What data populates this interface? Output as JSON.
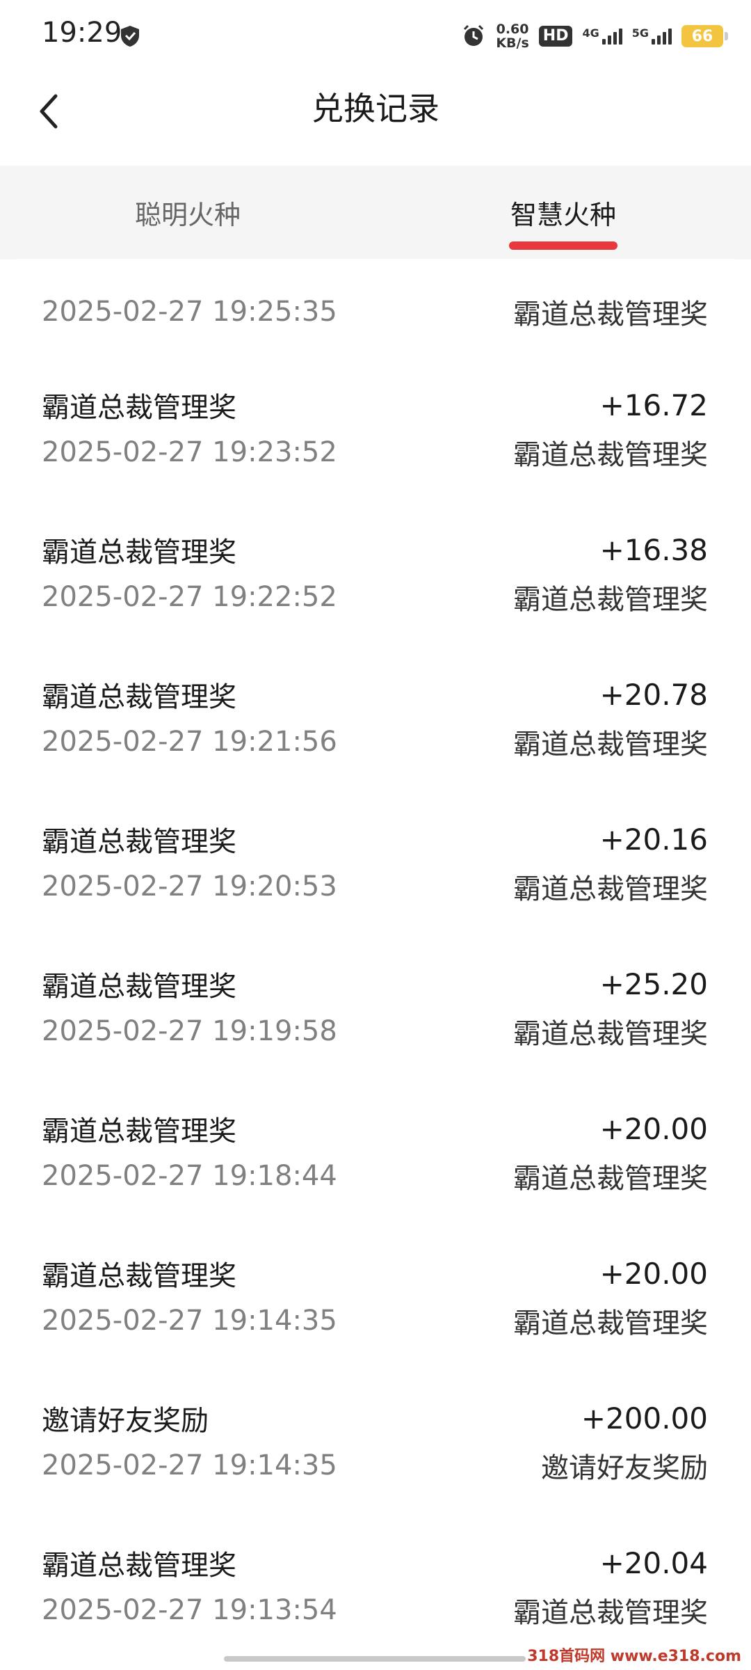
{
  "status_bar": {
    "time": "19:29",
    "speed_value": "0.60",
    "speed_unit": "KB/s",
    "hd_label": "HD",
    "net1": "4G",
    "net2": "5G",
    "battery": "66"
  },
  "header": {
    "title": "兑换记录"
  },
  "tabs": [
    {
      "label": "聪明火种",
      "active": false
    },
    {
      "label": "智慧火种",
      "active": true
    }
  ],
  "first_record": {
    "date": "2025-02-27 19:25:35",
    "type": "霸道总裁管理奖"
  },
  "records": [
    {
      "title": "霸道总裁管理奖",
      "amount": "+16.72",
      "date": "2025-02-27 19:23:52",
      "type": "霸道总裁管理奖"
    },
    {
      "title": "霸道总裁管理奖",
      "amount": "+16.38",
      "date": "2025-02-27 19:22:52",
      "type": "霸道总裁管理奖"
    },
    {
      "title": "霸道总裁管理奖",
      "amount": "+20.78",
      "date": "2025-02-27 19:21:56",
      "type": "霸道总裁管理奖"
    },
    {
      "title": "霸道总裁管理奖",
      "amount": "+20.16",
      "date": "2025-02-27 19:20:53",
      "type": "霸道总裁管理奖"
    },
    {
      "title": "霸道总裁管理奖",
      "amount": "+25.20",
      "date": "2025-02-27 19:19:58",
      "type": "霸道总裁管理奖"
    },
    {
      "title": "霸道总裁管理奖",
      "amount": "+20.00",
      "date": "2025-02-27 19:18:44",
      "type": "霸道总裁管理奖"
    },
    {
      "title": "霸道总裁管理奖",
      "amount": "+20.00",
      "date": "2025-02-27 19:14:35",
      "type": "霸道总裁管理奖"
    },
    {
      "title": "邀请好友奖励",
      "amount": "+200.00",
      "date": "2025-02-27 19:14:35",
      "type": "邀请好友奖励"
    },
    {
      "title": "霸道总裁管理奖",
      "amount": "+20.04",
      "date": "2025-02-27 19:13:54",
      "type": "霸道总裁管理奖"
    }
  ],
  "watermark": "318首码网 www.e318.com",
  "colors": {
    "accent": "#e8383d",
    "battery": "#f2c440",
    "tab_bg": "#f5f5f5"
  }
}
